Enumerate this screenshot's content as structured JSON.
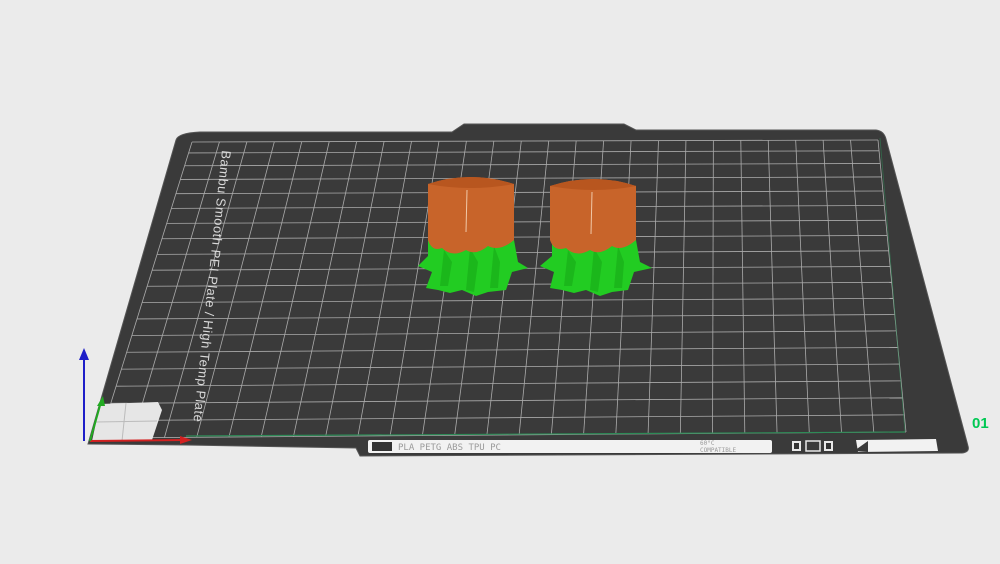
{
  "viewport": {
    "name": "3D build plate view",
    "background": "#ebebeb"
  },
  "plate": {
    "label": "Bambu Smooth PEI Plate / High Temp Plate",
    "strip_text": "PLA  PETG  ABS  TPU  PC",
    "strip_text_small_top": "60°C",
    "strip_text_small_bottom": "COMPATIBLE",
    "color_plate": "#3a3a3a",
    "color_grid": "#bfbfbf",
    "color_edge": "#2a2a2a"
  },
  "plate_number": {
    "text": "01",
    "color": "#00c853"
  },
  "axes": {
    "x_color": "#d32020",
    "y_color": "#22aa22",
    "z_color": "#1e1ec8"
  },
  "objects": [
    {
      "name": "model-1",
      "body_color": "#c8642a",
      "support_color": "#22cc22"
    },
    {
      "name": "model-2",
      "body_color": "#c8642a",
      "support_color": "#22cc22"
    }
  ],
  "icons": [
    "warning-icon",
    "rectangle-icon",
    "warning-icon-2",
    "toggle-icon"
  ]
}
